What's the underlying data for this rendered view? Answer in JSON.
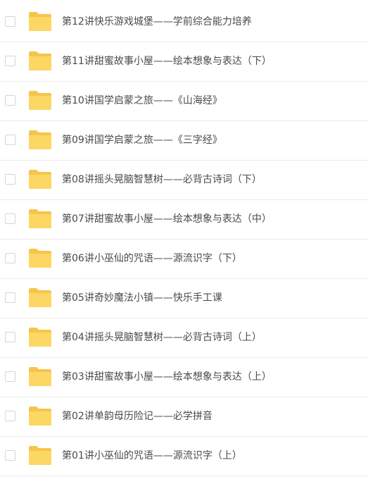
{
  "colors": {
    "folder_back": "#F5C54B",
    "folder_front": "#FCD764",
    "text": "#4A4A4A",
    "divider": "#ECECEC",
    "checkbox_border": "#D6D6D6"
  },
  "files": [
    {
      "icon": "folder-icon",
      "name": "第12讲快乐游戏城堡——学前综合能力培养"
    },
    {
      "icon": "folder-icon",
      "name": "第11讲甜蜜故事小屋——绘本想象与表达（下）"
    },
    {
      "icon": "folder-icon",
      "name": "第10讲国学启蒙之旅——《山海经》"
    },
    {
      "icon": "folder-icon",
      "name": "第09讲国学启蒙之旅——《三字经》"
    },
    {
      "icon": "folder-icon",
      "name": "第08讲摇头晃脑智慧树——必背古诗词（下）"
    },
    {
      "icon": "folder-icon",
      "name": "第07讲甜蜜故事小屋——绘本想象与表达（中）"
    },
    {
      "icon": "folder-icon",
      "name": "第06讲小巫仙的咒语——源流识字（下）"
    },
    {
      "icon": "folder-icon",
      "name": "第05讲奇妙魔法小镇——快乐手工课"
    },
    {
      "icon": "folder-icon",
      "name": "第04讲摇头晃脑智慧树——必背古诗词（上）"
    },
    {
      "icon": "folder-icon",
      "name": "第03讲甜蜜故事小屋——绘本想象与表达（上）"
    },
    {
      "icon": "folder-icon",
      "name": "第02讲单韵母历险记——必学拼音"
    },
    {
      "icon": "folder-icon",
      "name": "第01讲小巫仙的咒语——源流识字（上）"
    }
  ]
}
